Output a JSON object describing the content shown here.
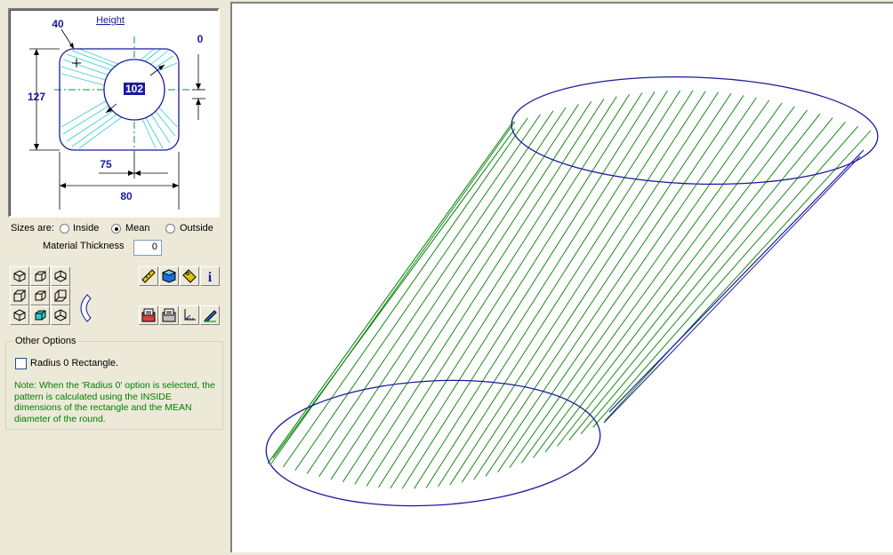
{
  "preview": {
    "height_link": "Height",
    "dims": {
      "corner_radius": "40",
      "offset": "0",
      "height": "127",
      "diameter": "102",
      "x_offset": "75",
      "width": "80"
    }
  },
  "sizes": {
    "label": "Sizes are:",
    "options": [
      "Inside",
      "Mean",
      "Outside"
    ],
    "selected": "Mean"
  },
  "material_thickness": {
    "label": "Material Thickness",
    "value": "0"
  },
  "toolbar": {
    "view_icons": [
      "view-iso-1",
      "view-iso-2",
      "view-iso-3",
      "view-iso-4",
      "view-iso-5",
      "view-iso-6",
      "view-iso-7",
      "view-iso-8",
      "view-iso-9",
      "rotate-view"
    ],
    "action_icons": [
      "ruler",
      "3d-box",
      "tag",
      "info",
      "print-pattern",
      "print-document",
      "axis",
      "edit"
    ]
  },
  "other_options": {
    "legend": "Other Options",
    "radius0_label": "Radius 0 Rectangle.",
    "radius0_checked": false,
    "note": "Note:   When the 'Radius 0' option is selected, the pattern is calculated using the INSIDE dimensions of the rectangle and the MEAN diameter of the round."
  },
  "colors": {
    "outline": "#1a1a9e",
    "hatch": "#008000",
    "preview_pattern": "#33cccc",
    "centerline": "#009933",
    "dimension": "#1a1a9e",
    "note_text": "#008000"
  }
}
